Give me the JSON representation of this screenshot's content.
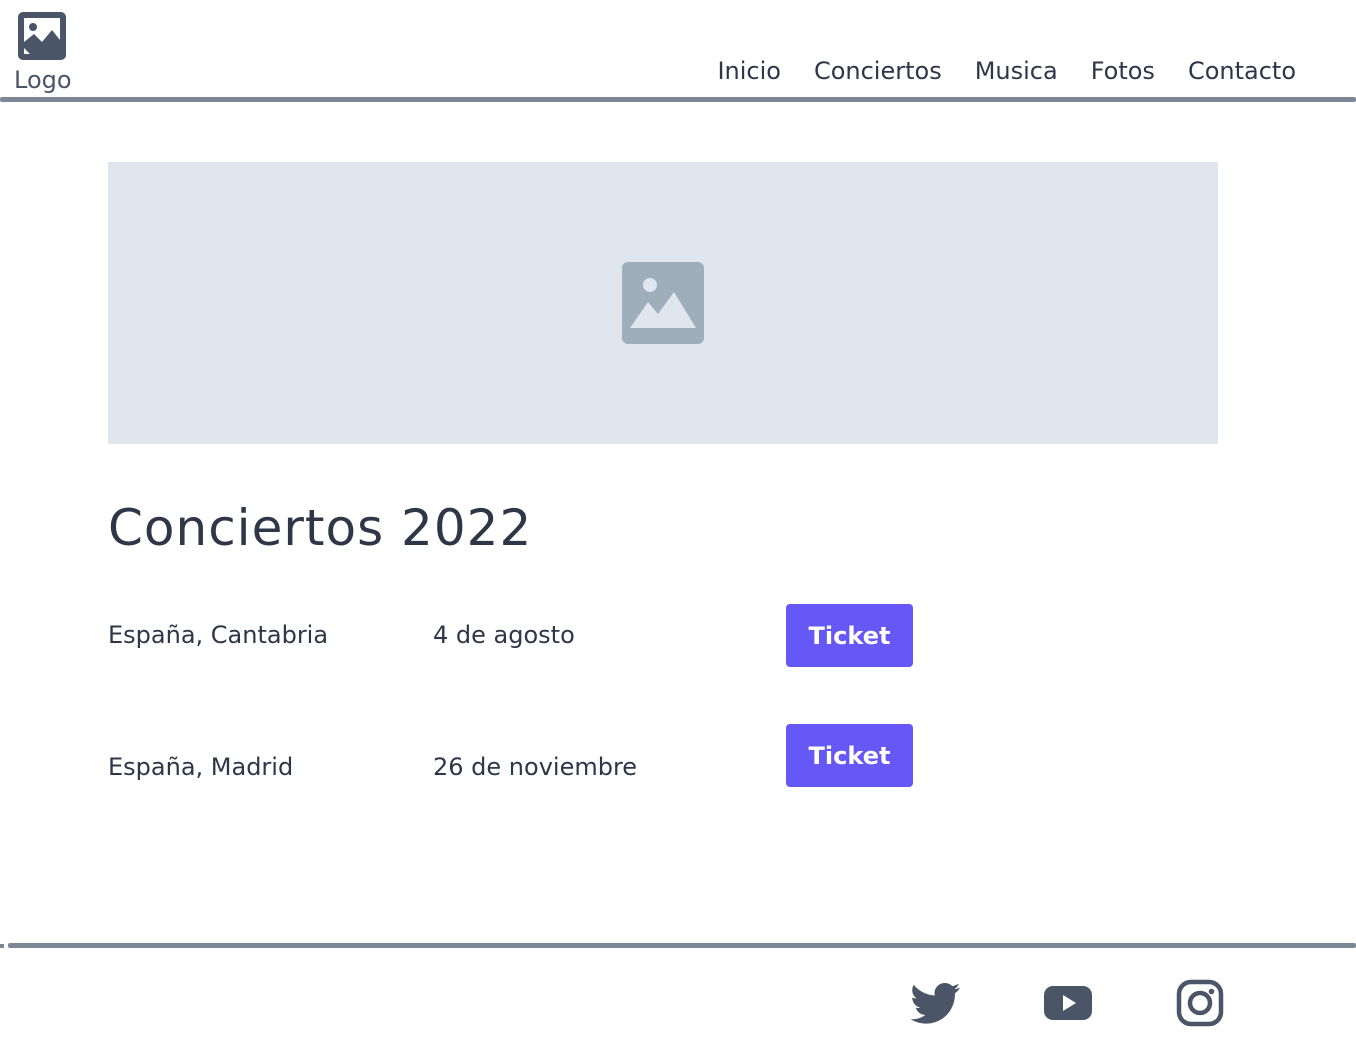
{
  "header": {
    "logo_label": "Logo",
    "nav": [
      {
        "label": "Inicio"
      },
      {
        "label": "Conciertos"
      },
      {
        "label": "Musica"
      },
      {
        "label": "Fotos"
      },
      {
        "label": "Contacto"
      }
    ]
  },
  "hero": {
    "icon": "image-placeholder-icon"
  },
  "concerts": {
    "title": "Conciertos 2022",
    "items": [
      {
        "place": "España, Cantabria",
        "date": "4 de agosto",
        "button": "Ticket"
      },
      {
        "place": "España, Madrid",
        "date": "26 de noviembre",
        "button": "Ticket"
      }
    ]
  },
  "footer": {
    "social": [
      {
        "icon": "twitter-icon"
      },
      {
        "icon": "youtube-icon"
      },
      {
        "icon": "instagram-icon"
      }
    ]
  },
  "colors": {
    "accent": "#6658f6",
    "divider": "#7c8796",
    "hero_bg": "#e0e6ee",
    "text": "#2d3748"
  }
}
